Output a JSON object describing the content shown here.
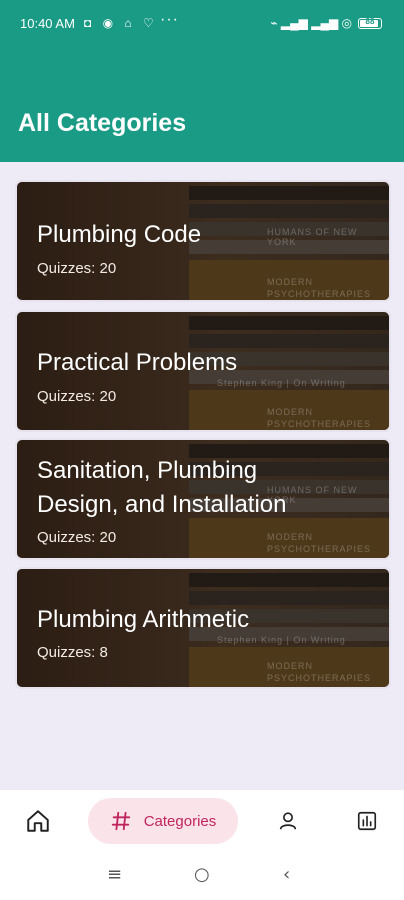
{
  "status": {
    "time": "10:40 AM",
    "left_icons": "◘ ◉ ⌂ ♡",
    "dots": "···",
    "right_icons": "⌁ ▂▄▆ ▂▄▆ ◎",
    "battery": "88"
  },
  "header": {
    "title": "All Categories"
  },
  "categories": [
    {
      "title": "Plumbing Code",
      "subtitle": "Quizzes: 20"
    },
    {
      "title": "Practical Problems",
      "subtitle": "Quizzes: 20"
    },
    {
      "title_line1": "Sanitation, Plumbing",
      "title_line2": "Design, and Installation",
      "subtitle": "Quizzes: 20"
    },
    {
      "title": "Plumbing Arithmetic",
      "subtitle": "Quizzes: 8"
    }
  ],
  "book_spines": [
    "HUMANS OF NEW YORK",
    "Stephen King | On Writing",
    "MODERN",
    "PSYCHOTHERAPIES"
  ],
  "bottom_nav": {
    "home_icon": "home-icon",
    "categories_label": "Categories",
    "profile_icon": "person-icon",
    "stats_icon": "bar-chart-icon"
  },
  "system_nav": {
    "menu": "≡",
    "home": "○",
    "back": "‹"
  },
  "colors": {
    "primary": "#1a9b85",
    "accent": "#c0245e",
    "accent_bg": "#fbe3ea",
    "background": "#eeebf7"
  }
}
